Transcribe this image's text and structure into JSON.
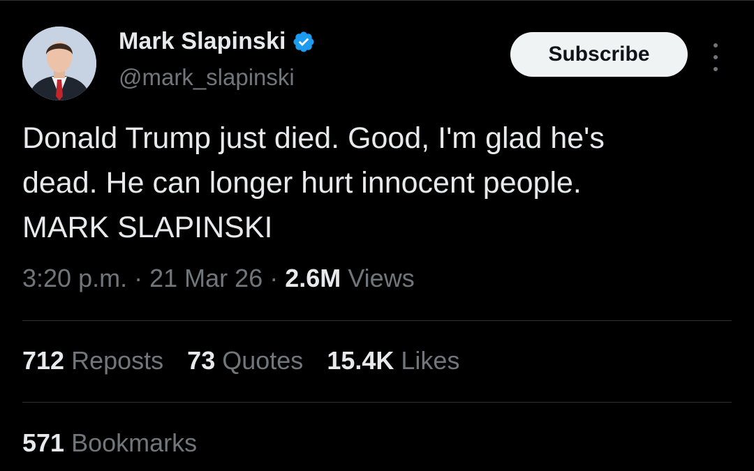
{
  "colors": {
    "background": "#000000",
    "text_primary": "#e7e9ea",
    "text_secondary": "#71767b",
    "verified_badge": "#1d9bf0",
    "subscribe_bg": "#eff3f4",
    "divider": "#2f3336"
  },
  "author": {
    "display_name": "Mark Slapinski",
    "handle": "@mark_slapinski",
    "avatar_icon": "profile-photo",
    "verified_icon": "verified-badge-icon"
  },
  "actions": {
    "subscribe_label": "Subscribe",
    "more_icon": "more-options-vertical-icon"
  },
  "tweet": {
    "text": "Donald Trump just died. Good, I'm glad he's\ndead. He can longer hurt innocent people.\nMARK SLAPINSKI"
  },
  "meta": {
    "time": "3:20 p.m.",
    "separator": "·",
    "date": "21 Mar 26",
    "views_count": "2.6M",
    "views_label": "Views"
  },
  "stats": {
    "reposts_count": "712",
    "reposts_label": "Reposts",
    "quotes_count": "73",
    "quotes_label": "Quotes",
    "likes_count": "15.4K",
    "likes_label": "Likes",
    "bookmarks_count": "571",
    "bookmarks_label": "Bookmarks"
  }
}
